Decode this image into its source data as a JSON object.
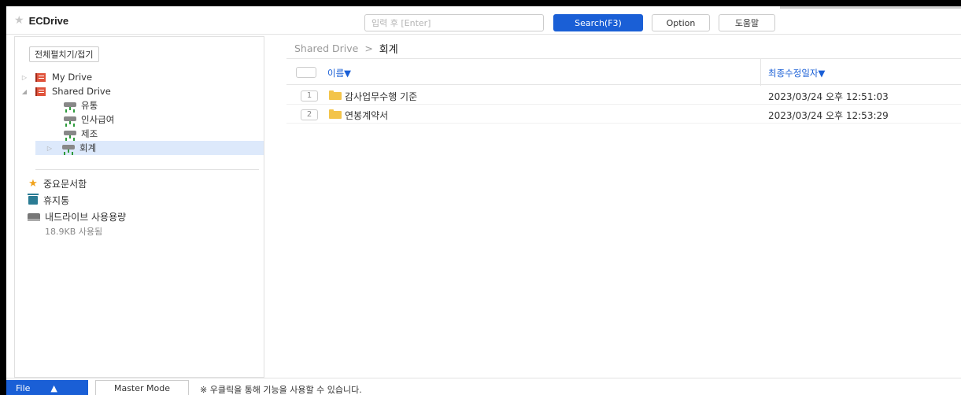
{
  "app": {
    "title": "ECDrive"
  },
  "search": {
    "placeholder": "입력 후 [Enter]",
    "button_label": "Search(F3)"
  },
  "toolbar": {
    "option_label": "Option",
    "help_label": "도움말"
  },
  "sidebar": {
    "toggle_label": "전체펼치기/접기",
    "tree": [
      {
        "label": "My Drive",
        "expander": "▷",
        "icon": "drive-book-icon",
        "level": 0
      },
      {
        "label": "Shared Drive",
        "expander": "◢",
        "icon": "drive-book-icon",
        "level": 0
      },
      {
        "label": "유통",
        "expander": "",
        "icon": "network-drive-icon",
        "level": 1
      },
      {
        "label": "인사급여",
        "expander": "",
        "icon": "network-drive-icon",
        "level": 1
      },
      {
        "label": "제조",
        "expander": "",
        "icon": "network-drive-icon",
        "level": 1
      },
      {
        "label": "회계",
        "expander": "▷",
        "icon": "network-drive-icon",
        "level": 1,
        "selected": true
      }
    ],
    "important_label": "중요문서함",
    "trash_label": "휴지통",
    "usage_label": "내드라이브 사용용량",
    "usage_value": "18.9KB 사용됨"
  },
  "breadcrumb": {
    "root": "Shared Drive",
    "separator": ">",
    "current": "회계"
  },
  "table": {
    "columns": {
      "name": "이름▼",
      "modified": "최종수정일자▼"
    },
    "rows": [
      {
        "index": "1",
        "name": "감사업무수행 기준",
        "modified": "2023/03/24 오후 12:51:03"
      },
      {
        "index": "2",
        "name": "연봉계약서",
        "modified": "2023/03/24 오후 12:53:29"
      }
    ]
  },
  "footer": {
    "file_label": "File",
    "file_arrow": "▲",
    "master_label": "Master Mode",
    "hint": "※ 우클릭을 통해 기능을 사용할 수 있습니다."
  },
  "colors": {
    "accent": "#1a5fd6",
    "selected_row": "#dde9fb",
    "folder": "#f3c44a"
  }
}
